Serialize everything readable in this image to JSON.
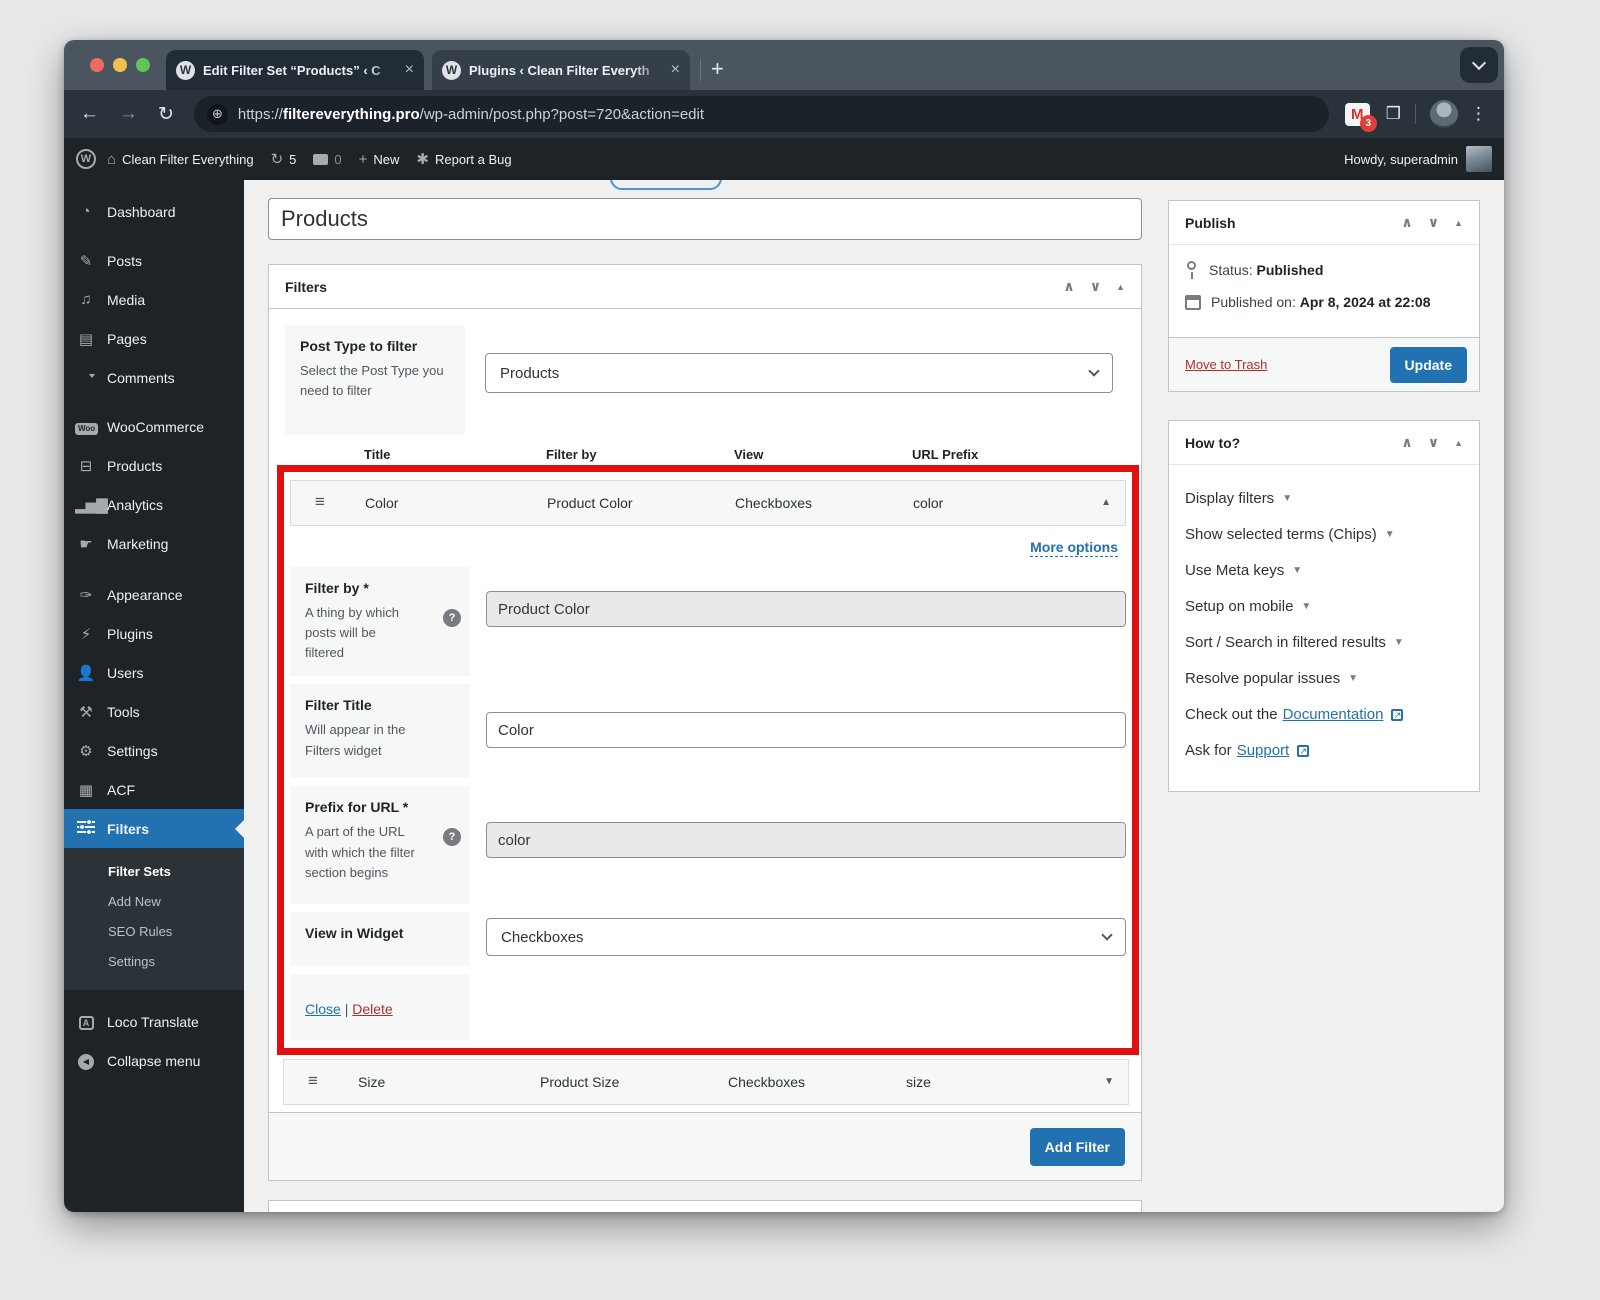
{
  "browser": {
    "tab1_title": "Edit Filter Set “Products” ‹ C",
    "tab2_title": "Plugins ‹ Clean Filter Everyth",
    "url_scheme": "https://",
    "url_domain": "filtereverything.pro",
    "url_path": "/wp-admin/post.php?post=720&action=edit",
    "gmail_badge": "3"
  },
  "icons": {
    "wp": "W",
    "home": "⌂",
    "updates": "↻",
    "plus": "+",
    "bug": "✱",
    "back": "←",
    "forward": "→",
    "reload": "↻",
    "globe": "⊕",
    "gmail": "M",
    "dots": "⋮",
    "close": "×",
    "newtab": "+",
    "dashboard": "◔",
    "posts": "✎",
    "media": "♫",
    "pages": "▤",
    "woo": "Woo",
    "products": "⊟",
    "analytics": "▂▅▇",
    "marketing": "☛",
    "appearance": "✑",
    "plugins": "⚡",
    "tools": "⚒",
    "settings": "⚙",
    "acf": "▦",
    "loco": "A",
    "collapse": "◀",
    "handle": "≡",
    "up": "∧",
    "down": "∨",
    "tri_up": "▲",
    "tri_down": "▼",
    "caret": "▼",
    "help": "?",
    "ext": "↗"
  },
  "adminbar": {
    "site": "Clean Filter Everything",
    "updates": "5",
    "comments": "0",
    "new": "New",
    "bug": "Report a Bug",
    "howdy": "Howdy, superadmin"
  },
  "sidebar": {
    "items": [
      "Dashboard",
      "Posts",
      "Media",
      "Pages",
      "Comments",
      "WooCommerce",
      "Products",
      "Analytics",
      "Marketing",
      "Appearance",
      "Plugins",
      "Users",
      "Tools",
      "Settings",
      "ACF",
      "Filters"
    ],
    "submenu": [
      "Filter Sets",
      "Add New",
      "SEO Rules",
      "Settings"
    ],
    "loco": "Loco Translate",
    "collapse": "Collapse menu"
  },
  "main": {
    "post_title": "Products",
    "panel_title": "Filters",
    "post_type_label": "Post Type to filter",
    "post_type_desc": "Select the Post Type you need to filter",
    "post_type_value": "Products",
    "col_title": "Title",
    "col_filter_by": "Filter by",
    "col_view": "View",
    "col_url_prefix": "URL Prefix",
    "row_color": {
      "title": "Color",
      "filter_by": "Product Color",
      "view": "Checkboxes",
      "prefix": "color"
    },
    "row_size": {
      "title": "Size",
      "filter_by": "Product Size",
      "view": "Checkboxes",
      "prefix": "size"
    },
    "more_options": "More options",
    "f_filter_by_label": "Filter by *",
    "f_filter_by_desc": "A thing by which posts will be filtered",
    "f_filter_by_value": "Product Color",
    "f_title_label": "Filter Title",
    "f_title_desc": "Will appear in the Filters widget",
    "f_title_value": "Color",
    "f_prefix_label": "Prefix for URL *",
    "f_prefix_desc": "A part of the URL with which the filter section begins",
    "f_prefix_value": "color",
    "f_view_label": "View in Widget",
    "f_view_value": "Checkboxes",
    "close": "Close",
    "delete": "Delete",
    "add_filter": "Add Filter"
  },
  "publish": {
    "title": "Publish",
    "status_label": "Status:",
    "status_value": "Published",
    "published_label": "Published on:",
    "published_value": "Apr 8, 2024 at 22:08",
    "trash": "Move to Trash",
    "update": "Update"
  },
  "howto": {
    "title": "How to?",
    "items": [
      "Display filters",
      "Show selected terms (Chips)",
      "Use Meta keys",
      "Setup on mobile",
      "Sort / Search in filtered results",
      "Resolve popular issues"
    ],
    "doc_prefix": "Check out the",
    "doc_link": "Documentation",
    "support_prefix": "Ask for",
    "support_link": "Support"
  }
}
